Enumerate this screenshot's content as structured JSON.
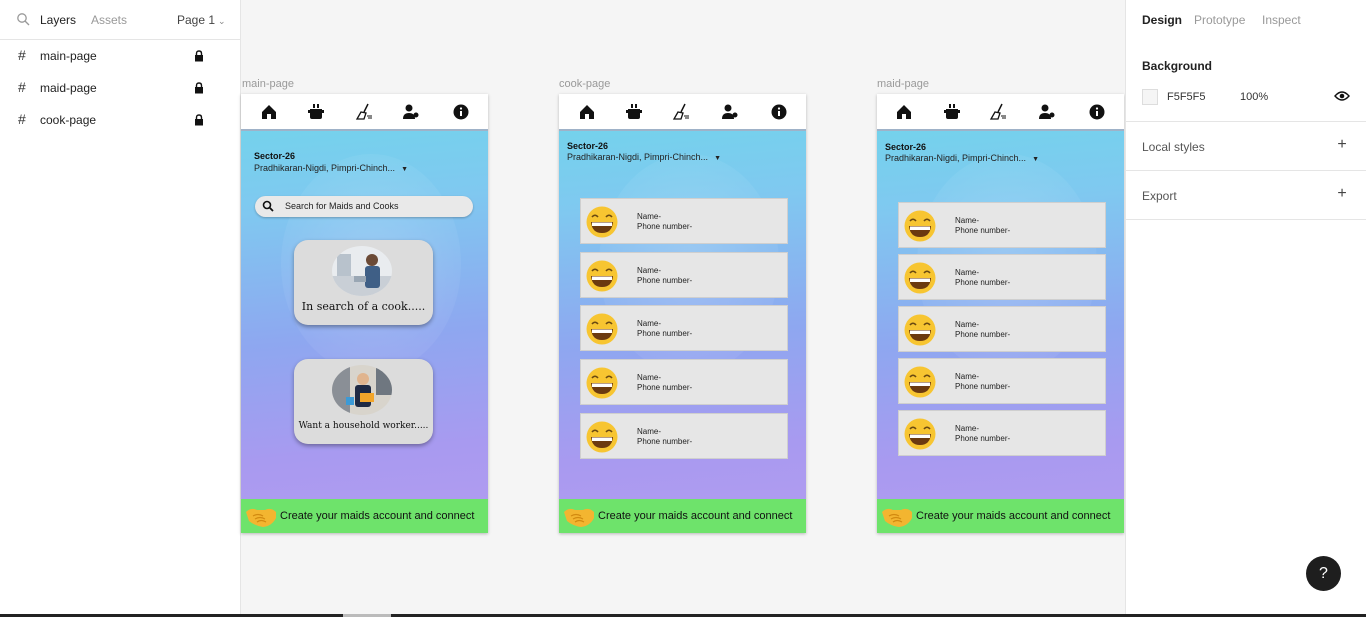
{
  "left_panel": {
    "tabs": {
      "layers": "Layers",
      "assets": "Assets",
      "page": "Page 1"
    },
    "layers": [
      {
        "name": "main-page"
      },
      {
        "name": "maid-page"
      },
      {
        "name": "cook-page"
      }
    ]
  },
  "right_panel": {
    "tabs": {
      "design": "Design",
      "prototype": "Prototype",
      "inspect": "Inspect"
    },
    "background": {
      "title": "Background",
      "hex": "F5F5F5",
      "opacity": "100%",
      "color": "#F5F5F5"
    },
    "local_styles": "Local styles",
    "export": "Export"
  },
  "help": "?",
  "frames": {
    "main": {
      "label": "main-page",
      "location_title": "Sector-26",
      "location_sub": "Pradhikaran-Nigdi, Pimpri-Chinch...",
      "search_placeholder": "Search for Maids and Cooks",
      "card_cook": "In search of a cook.....",
      "card_worker": "Want a household worker.....",
      "footer": "Create your maids account and connect"
    },
    "cook": {
      "label": "cook-page",
      "location_title": "Sector-26",
      "location_sub": "Pradhikaran-Nigdi, Pimpri-Chinch...",
      "entries": [
        {
          "name": "Name-",
          "phone": "Phone number-"
        },
        {
          "name": "Name-",
          "phone": "Phone number-"
        },
        {
          "name": "Name-",
          "phone": "Phone number-"
        },
        {
          "name": "Name-",
          "phone": "Phone number-"
        },
        {
          "name": "Name-",
          "phone": "Phone number-"
        }
      ],
      "footer": "Create your maids account and connect"
    },
    "maid": {
      "label": "maid-page",
      "location_title": "Sector-26",
      "location_sub": "Pradhikaran-Nigdi, Pimpri-Chinch...",
      "entries": [
        {
          "name": "Name-",
          "phone": "Phone number-"
        },
        {
          "name": "Name-",
          "phone": "Phone number-"
        },
        {
          "name": "Name-",
          "phone": "Phone number-"
        },
        {
          "name": "Name-",
          "phone": "Phone number-"
        },
        {
          "name": "Name-",
          "phone": "Phone number-"
        }
      ],
      "footer": "Create your maids account and connect"
    }
  },
  "nav_icons": [
    "home-icon",
    "cooking-pot-icon",
    "broom-icon",
    "account-icon",
    "info-icon"
  ],
  "colors": {
    "footer_green": "#6ee36b",
    "canvas": "#F5F5F5"
  }
}
